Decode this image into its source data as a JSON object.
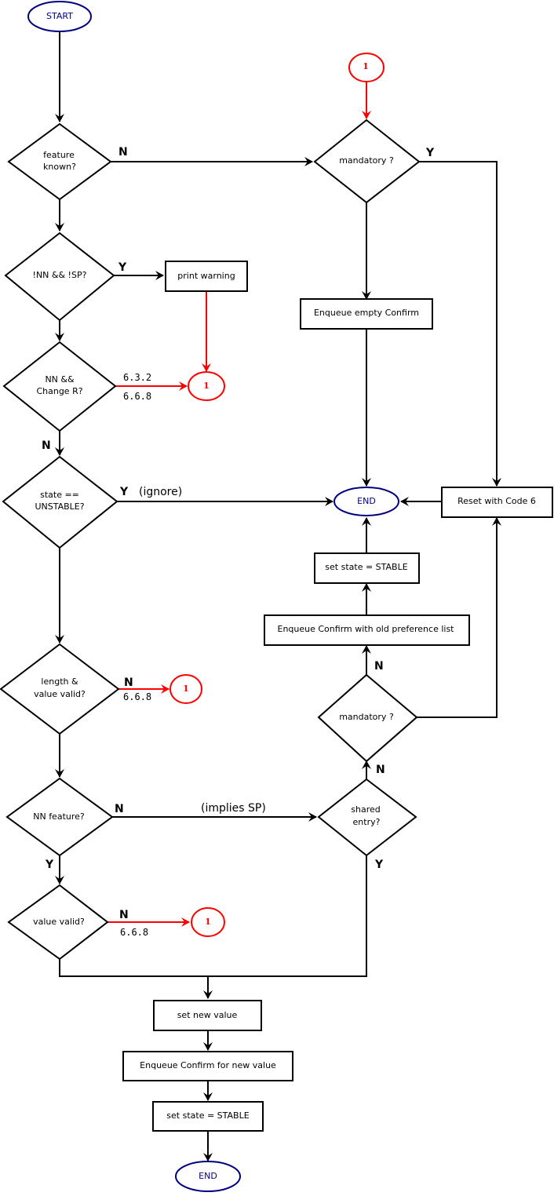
{
  "colors": {
    "terminal": "#000080",
    "connector": "#ff0000",
    "line": "#000000"
  },
  "nodes": {
    "start": "START",
    "feature_known": [
      "feature",
      "known?"
    ],
    "not_nn_not_sp": "!NN  && !SP?",
    "print_warning": "print warning",
    "nn_change_r": [
      "NN  &&",
      "Change R?"
    ],
    "state_unstable": [
      "state ==",
      "UNSTABLE?"
    ],
    "length_value_valid": [
      "length &",
      "value valid?"
    ],
    "nn_feature": "NN feature?",
    "value_valid": "value valid?",
    "set_new_value": "set  new value",
    "enqueue_confirm_new": "Enqueue Confirm for new value",
    "set_state_stable_bottom": "set state = STABLE",
    "end_bottom": "END",
    "connector_top": "1",
    "mandatory_top": "mandatory ?",
    "enqueue_empty_confirm": "Enqueue empty Confirm",
    "end_mid": "END",
    "reset_code6": "Reset with Code 6",
    "set_state_stable_right": "set state = STABLE",
    "enqueue_confirm_old": "Enqueue Confirm with old preference list",
    "mandatory_mid": "mandatory ?",
    "shared_entry": [
      "shared",
      "entry?"
    ],
    "connector_a": "1",
    "connector_b": "1",
    "connector_c": "1"
  },
  "edge_labels": {
    "feature_known_n": "N",
    "mandatory_top_y": "Y",
    "not_nn_sp_y": "Y",
    "nn_change_r_ref1": "6.3.2",
    "nn_change_r_ref2": "6.6.8",
    "nn_change_r_n": "N",
    "state_unstable_y": "Y",
    "ignore_note": "(ignore)",
    "length_valid_n": "N",
    "length_valid_ref": "6.6.8",
    "nn_feature_n": "N",
    "implies_sp": "(implies SP)",
    "nn_feature_y": "Y",
    "value_valid_n": "N",
    "value_valid_ref": "6.6.8",
    "shared_entry_n": "N",
    "shared_entry_y": "Y",
    "mandatory_mid_n": "N"
  }
}
